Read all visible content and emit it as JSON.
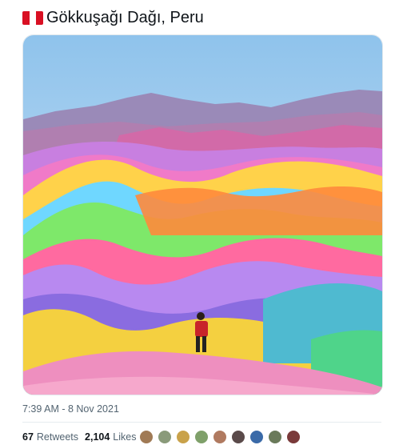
{
  "tweet": {
    "flag_icon": "peru-flag-icon",
    "text": "Gökkuşağı Dağı, Peru",
    "photo_icon": "rainbow-mountains-photo",
    "timestamp": "7:39 AM - 8 Nov 2021"
  },
  "stats": {
    "retweets_count": "67",
    "retweets_label": "Retweets",
    "likes_count": "2,104",
    "likes_label": "Likes",
    "liker_avatars": [
      {
        "name": "liker-avatar",
        "color": "#a07a55"
      },
      {
        "name": "liker-avatar",
        "color": "#8a9a7a"
      },
      {
        "name": "liker-avatar",
        "color": "#c9a24a"
      },
      {
        "name": "liker-avatar",
        "color": "#7fa06a"
      },
      {
        "name": "liker-avatar",
        "color": "#b07a60"
      },
      {
        "name": "liker-avatar",
        "color": "#5a4a4a"
      },
      {
        "name": "liker-avatar",
        "color": "#3a6aa8"
      },
      {
        "name": "liker-avatar",
        "color": "#6a7a5a"
      },
      {
        "name": "liker-avatar",
        "color": "#7a3a3a"
      }
    ]
  },
  "colors": {
    "flag_red": "#d91023",
    "meta_text": "#536471"
  }
}
